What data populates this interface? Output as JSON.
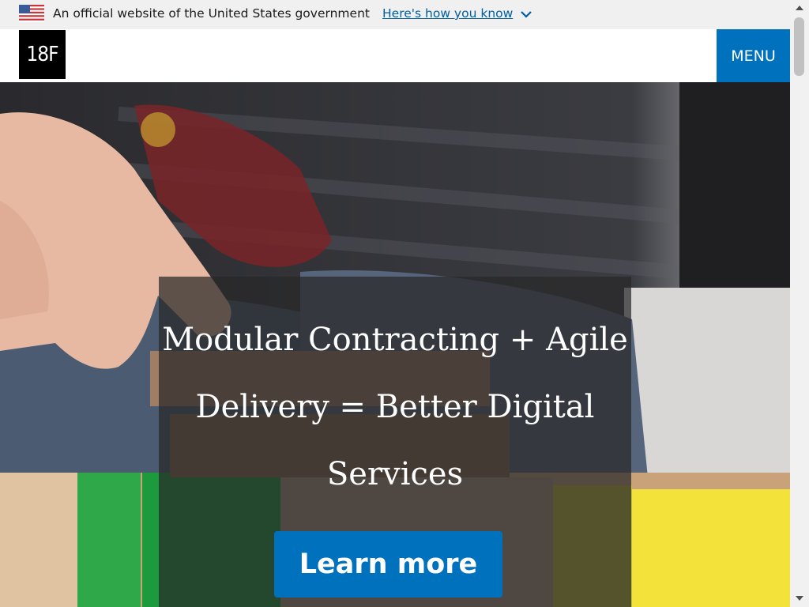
{
  "banner": {
    "text": "An official website of the United States government",
    "link": "Here's how you know"
  },
  "header": {
    "logo": "18F",
    "menu_label": "MENU"
  },
  "hero": {
    "title": "Modular Contracting + Agile Delivery = Better Digital Services",
    "button_label": "Learn more"
  },
  "colors": {
    "primary_blue": "#0071bc",
    "banner_bg": "#f0f0f0",
    "link_blue": "#005ea2"
  }
}
